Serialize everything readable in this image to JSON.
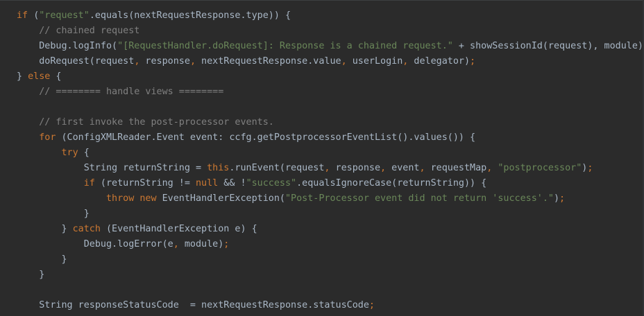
{
  "editor": {
    "lines": [
      [
        [
          "kw",
          "if "
        ],
        [
          "txt",
          "("
        ],
        [
          "str",
          "\"request\""
        ],
        [
          "txt",
          ".equals(nextRequestResponse.type)) {"
        ]
      ],
      [
        [
          "txt",
          "    "
        ],
        [
          "cm",
          "// chained request"
        ]
      ],
      [
        [
          "txt",
          "    Debug.logInfo("
        ],
        [
          "str",
          "\"[RequestHandler.doRequest]: Response is a chained request.\""
        ],
        [
          "txt",
          " + showSessionId(request), module)"
        ],
        [
          "kw",
          ";"
        ]
      ],
      [
        [
          "txt",
          "    doRequest(request"
        ],
        [
          "kw",
          ","
        ],
        [
          "txt",
          " response"
        ],
        [
          "kw",
          ","
        ],
        [
          "txt",
          " nextRequestResponse.value"
        ],
        [
          "kw",
          ","
        ],
        [
          "txt",
          " userLogin"
        ],
        [
          "kw",
          ","
        ],
        [
          "txt",
          " delegator)"
        ],
        [
          "kw",
          ";"
        ]
      ],
      [
        [
          "txt",
          "} "
        ],
        [
          "kw",
          "else"
        ],
        [
          "txt",
          " {"
        ]
      ],
      [
        [
          "txt",
          "    "
        ],
        [
          "cm",
          "// ======== handle views ========"
        ]
      ],
      [
        [
          "txt",
          ""
        ]
      ],
      [
        [
          "txt",
          "    "
        ],
        [
          "cm",
          "// first invoke the post-processor events."
        ]
      ],
      [
        [
          "txt",
          "    "
        ],
        [
          "kw",
          "for"
        ],
        [
          "txt",
          " (ConfigXMLReader.Event event: ccfg.getPostprocessorEventList().values()) {"
        ]
      ],
      [
        [
          "txt",
          "        "
        ],
        [
          "kw",
          "try"
        ],
        [
          "txt",
          " {"
        ]
      ],
      [
        [
          "txt",
          "            String returnString = "
        ],
        [
          "kw",
          "this"
        ],
        [
          "txt",
          ".runEvent(request"
        ],
        [
          "kw",
          ","
        ],
        [
          "txt",
          " response"
        ],
        [
          "kw",
          ","
        ],
        [
          "txt",
          " event"
        ],
        [
          "kw",
          ","
        ],
        [
          "txt",
          " requestMap"
        ],
        [
          "kw",
          ","
        ],
        [
          "txt",
          " "
        ],
        [
          "str",
          "\"postprocessor\""
        ],
        [
          "txt",
          ")"
        ],
        [
          "kw",
          ";"
        ]
      ],
      [
        [
          "txt",
          "            "
        ],
        [
          "kw",
          "if"
        ],
        [
          "txt",
          " (returnString != "
        ],
        [
          "kw",
          "null"
        ],
        [
          "txt",
          " && !"
        ],
        [
          "str",
          "\"success\""
        ],
        [
          "txt",
          ".equalsIgnoreCase(returnString)) {"
        ]
      ],
      [
        [
          "txt",
          "                "
        ],
        [
          "kw",
          "throw new"
        ],
        [
          "txt",
          " EventHandlerException("
        ],
        [
          "str",
          "\"Post-Processor event did not return 'success'.\""
        ],
        [
          "txt",
          ")"
        ],
        [
          "kw",
          ";"
        ]
      ],
      [
        [
          "txt",
          "            }"
        ]
      ],
      [
        [
          "txt",
          "        } "
        ],
        [
          "kw",
          "catch"
        ],
        [
          "txt",
          " (EventHandlerException e) {"
        ]
      ],
      [
        [
          "txt",
          "            Debug.logError(e"
        ],
        [
          "kw",
          ","
        ],
        [
          "txt",
          " module)"
        ],
        [
          "kw",
          ";"
        ]
      ],
      [
        [
          "txt",
          "        }"
        ]
      ],
      [
        [
          "txt",
          "    }"
        ]
      ],
      [
        [
          "txt",
          ""
        ]
      ],
      [
        [
          "txt",
          "    String responseStatusCode  = nextRequestResponse.statusCode"
        ],
        [
          "kw",
          ";"
        ]
      ]
    ]
  },
  "colors": {
    "background": "#2b2b2b",
    "keyword": "#cc7832",
    "string": "#6a8759",
    "comment": "#808080",
    "text": "#a9b7c6"
  }
}
